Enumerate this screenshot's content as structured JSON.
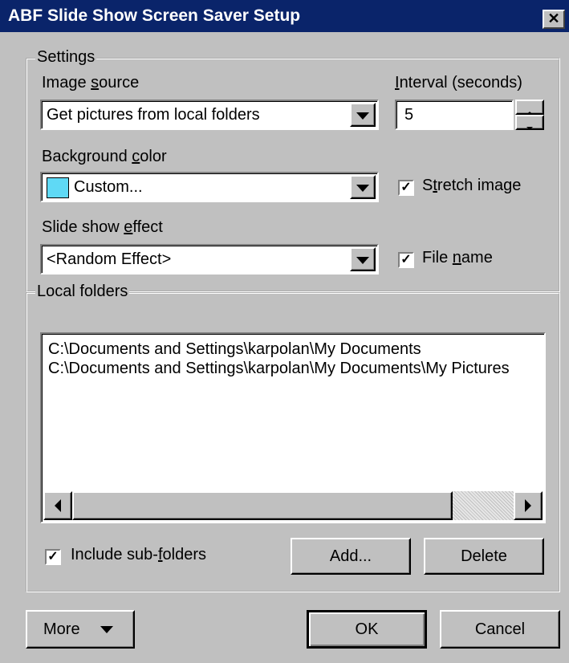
{
  "window": {
    "title": "ABF Slide Show Screen Saver Setup",
    "close_glyph": "✕"
  },
  "settings": {
    "legend": "Settings",
    "image_source": {
      "label_pre": "Image ",
      "label_key": "s",
      "label_post": "ource",
      "value": "Get pictures from local folders"
    },
    "interval": {
      "label_key": "I",
      "label_post": "nterval (seconds)",
      "value": "5"
    },
    "background_color": {
      "label_pre": "Background ",
      "label_key": "c",
      "label_post": "olor",
      "value": "Custom...",
      "swatch_color": "#5fd9f5"
    },
    "effect": {
      "label_pre": "Slide show ",
      "label_key": "e",
      "label_post": "ffect",
      "value": "<Random Effect>"
    },
    "stretch_image": {
      "label_pre": "S",
      "label_key": "t",
      "label_post": "retch image",
      "checked": true
    },
    "file_name": {
      "label_pre": "File ",
      "label_key": "n",
      "label_post": "ame",
      "checked": true
    }
  },
  "folders": {
    "legend": "Local folders",
    "items": [
      "C:\\Documents and Settings\\karpolan\\My Documents",
      "C:\\Documents and Settings\\karpolan\\My Documents\\My Pictures"
    ],
    "include_subfolders": {
      "label_pre": "Include sub-",
      "label_key": "f",
      "label_post": "olders",
      "checked": true
    },
    "add_label": "Add...",
    "delete_label": "Delete"
  },
  "footer": {
    "more_label": "More",
    "ok_label": "OK",
    "cancel_label": "Cancel"
  }
}
